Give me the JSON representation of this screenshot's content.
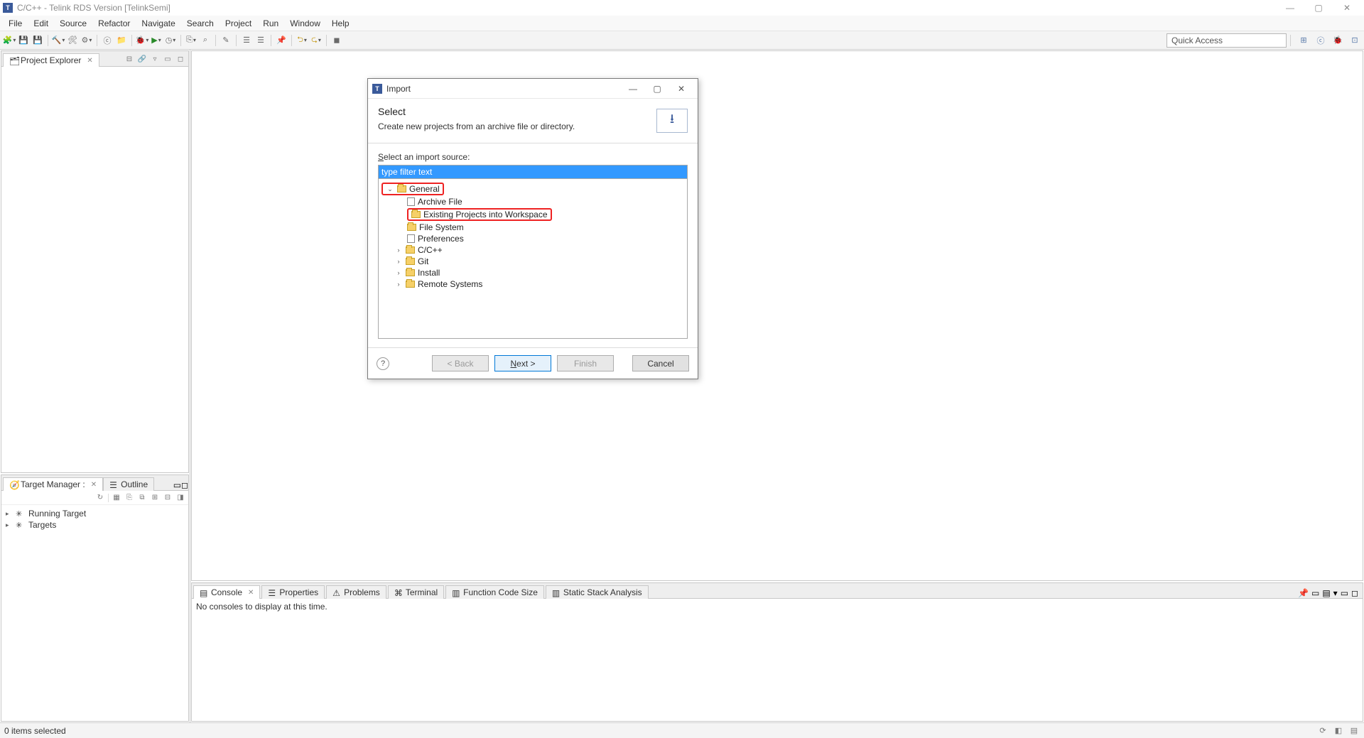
{
  "app": {
    "title": "C/C++ - Telink RDS Version [TelinkSemi]",
    "icon_letter": "T"
  },
  "menubar": [
    "File",
    "Edit",
    "Source",
    "Refactor",
    "Navigate",
    "Search",
    "Project",
    "Run",
    "Window",
    "Help"
  ],
  "toolbar": {
    "quick_access": "Quick Access"
  },
  "views": {
    "project_explorer": {
      "title": "Project Explorer"
    },
    "target_manager": {
      "title": "Target Manager :",
      "outline_tab": "Outline",
      "items": [
        "Running Target",
        "Targets"
      ]
    }
  },
  "bottom_tabs": [
    {
      "label": "Console",
      "active": true
    },
    {
      "label": "Properties",
      "active": false
    },
    {
      "label": "Problems",
      "active": false
    },
    {
      "label": "Terminal",
      "active": false
    },
    {
      "label": "Function Code Size",
      "active": false
    },
    {
      "label": "Static Stack Analysis",
      "active": false
    }
  ],
  "console": {
    "message": "No consoles to display at this time."
  },
  "statusbar": {
    "text": "0 items selected"
  },
  "dialog": {
    "title": "Import",
    "header": "Select",
    "description": "Create new projects from an archive file or directory.",
    "select_label": "Select an import source:",
    "filter_placeholder": "type filter text",
    "tree": {
      "general": {
        "label": "General",
        "children": [
          "Archive File",
          "Existing Projects into Workspace",
          "File System",
          "Preferences"
        ]
      },
      "others": [
        "C/C++",
        "Git",
        "Install",
        "Remote Systems"
      ]
    },
    "buttons": {
      "back": "< Back",
      "next": "Next >",
      "finish": "Finish",
      "cancel": "Cancel"
    }
  }
}
